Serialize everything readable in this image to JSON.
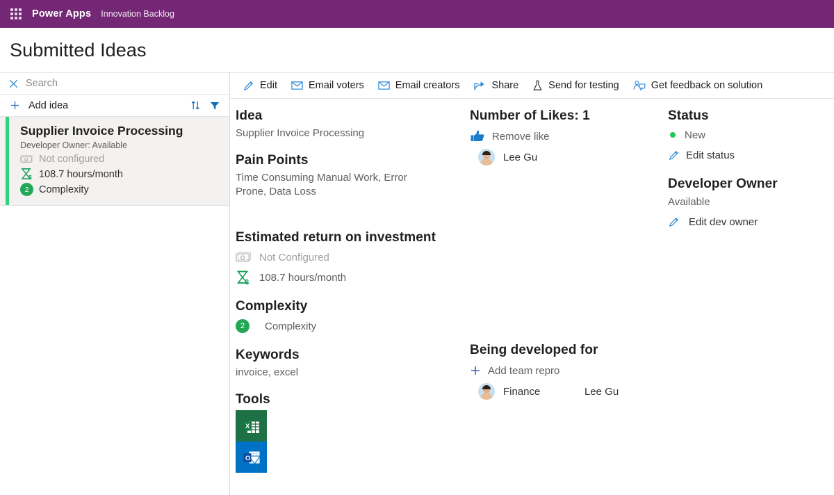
{
  "topbar": {
    "waffle_icon": "app-launcher-icon",
    "brand": "Power Apps",
    "app_name": "Innovation Backlog"
  },
  "page": {
    "title": "Submitted Ideas"
  },
  "sidebar": {
    "search": {
      "icon": "close-icon",
      "placeholder": "Search"
    },
    "add": {
      "icon": "plus-icon",
      "label": "Add idea"
    },
    "sort_icon": "sort-icon",
    "filter_icon": "filter-icon",
    "cards": [
      {
        "title": "Supplier Invoice Processing",
        "subtitle": "Developer Owner: Available",
        "roi_money_icon": "money-icon",
        "roi_money_text": "Not configured",
        "roi_hours_icon": "hourglass-dollar-icon",
        "roi_hours_text": "108.7 hours/month",
        "complexity_badge": "2",
        "complexity_text": "Complexity",
        "accent_color": "#2ed47a"
      }
    ]
  },
  "commandbar": {
    "items": [
      {
        "icon": "edit-pencil-icon",
        "label": "Edit"
      },
      {
        "icon": "mail-icon",
        "label": "Email voters"
      },
      {
        "icon": "mail-icon",
        "label": "Email creators"
      },
      {
        "icon": "share-icon",
        "label": "Share"
      },
      {
        "icon": "flask-icon",
        "label": "Send for testing"
      },
      {
        "icon": "feedback-person-icon",
        "label": "Get feedback on solution"
      }
    ]
  },
  "details": {
    "idea": {
      "heading": "Idea",
      "value": "Supplier Invoice Processing"
    },
    "pain_points": {
      "heading": "Pain Points",
      "value": "Time Consuming Manual Work, Error Prone, Data Loss"
    },
    "roi": {
      "heading": "Estimated return on investment",
      "money_icon": "money-icon",
      "money_text": "Not Configured",
      "hours_icon": "hourglass-dollar-icon",
      "hours_text": "108.7 hours/month"
    },
    "complexity": {
      "heading": "Complexity",
      "badge": "2",
      "label": "Complexity"
    },
    "keywords": {
      "heading": "Keywords",
      "value": "invoice, excel"
    },
    "tools": {
      "heading": "Tools",
      "items": [
        {
          "name": "excel-icon",
          "color": "#1e7145"
        },
        {
          "name": "outlook-icon",
          "color": "#0072c6"
        }
      ]
    }
  },
  "likes": {
    "heading": "Number of Likes: 1",
    "action_icon": "thumbs-up-icon",
    "action_label": "Remove like",
    "voters": [
      {
        "avatar": "avatar",
        "name": "Lee Gu"
      }
    ]
  },
  "developed_for": {
    "heading": "Being developed for",
    "add_icon": "plus-icon",
    "add_label": "Add team repro",
    "rows": [
      {
        "avatar": "avatar",
        "team": "Finance",
        "person": "Lee Gu"
      }
    ]
  },
  "status": {
    "heading": "Status",
    "dot_color": "#22c55e",
    "value": "New",
    "edit_icon": "edit-pencil-icon",
    "edit_label": "Edit status"
  },
  "developer_owner": {
    "heading": "Developer Owner",
    "value": "Available",
    "edit_icon": "edit-pencil-icon",
    "edit_label": "Edit dev owner"
  },
  "colors": {
    "brand_purple": "#742774",
    "accent_green": "#2ed47a",
    "link_blue": "#0078d4",
    "badge_green": "#23a757"
  }
}
